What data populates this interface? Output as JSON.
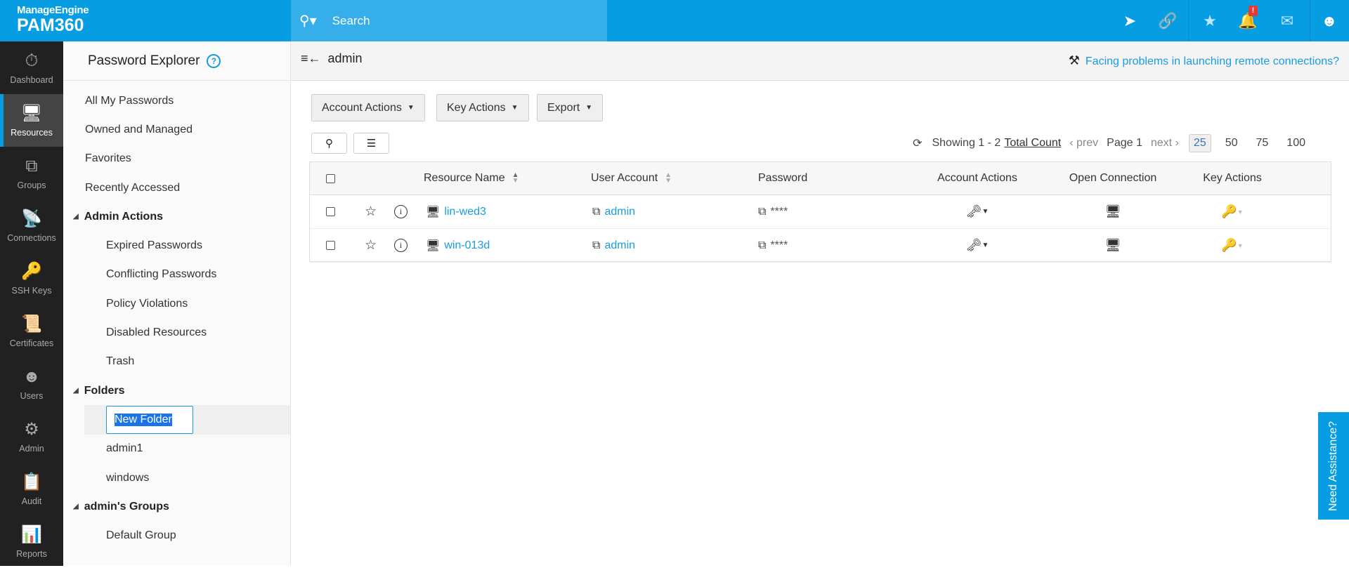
{
  "header": {
    "brand": "ManageEngine",
    "product": "PAM360",
    "search_placeholder": "Search",
    "notification_badge": "!"
  },
  "nav": [
    {
      "label": "Dashboard",
      "icon": "dashboard-icon"
    },
    {
      "label": "Resources",
      "icon": "monitor-icon",
      "active": true
    },
    {
      "label": "Groups",
      "icon": "groups-icon"
    },
    {
      "label": "Connections",
      "icon": "connections-icon"
    },
    {
      "label": "SSH Keys",
      "icon": "ssh-key-icon"
    },
    {
      "label": "Certificates",
      "icon": "certificate-icon"
    },
    {
      "label": "Users",
      "icon": "user-icon"
    },
    {
      "label": "Admin",
      "icon": "gear-icon"
    },
    {
      "label": "Audit",
      "icon": "clipboard-icon"
    },
    {
      "label": "Reports",
      "icon": "bar-chart-icon"
    }
  ],
  "explorer": {
    "title": "Password Explorer",
    "items": [
      "All My Passwords",
      "Owned and Managed",
      "Favorites",
      "Recently Accessed"
    ],
    "admin_actions": {
      "label": "Admin Actions",
      "items": [
        "Expired Passwords",
        "Conflicting Passwords",
        "Policy Violations",
        "Disabled Resources",
        "Trash"
      ]
    },
    "folders": {
      "label": "Folders",
      "editing": "New Folder",
      "items": [
        "admin1",
        "windows"
      ]
    },
    "groups": {
      "label": "admin's Groups",
      "items": [
        "Default Group"
      ]
    }
  },
  "main": {
    "breadcrumb": "admin",
    "help_link": "Facing problems in launching remote connections?",
    "buttons": {
      "account_actions": "Account Actions",
      "key_actions": "Key Actions",
      "export": "Export"
    },
    "pager": {
      "showing": "Showing 1 - 2",
      "total": "Total Count",
      "prev": "prev",
      "page": "Page 1",
      "next": "next",
      "sizes": [
        "25",
        "50",
        "75",
        "100"
      ],
      "selected_size": "25"
    },
    "columns": [
      "Resource Name",
      "User Account",
      "Password",
      "Account Actions",
      "Open Connection",
      "Key Actions"
    ],
    "rows": [
      {
        "resource": "lin-wed3",
        "account": "admin",
        "password": "****"
      },
      {
        "resource": "win-013d",
        "account": "admin",
        "password": "****"
      }
    ]
  },
  "assist": "Need Assistance?"
}
